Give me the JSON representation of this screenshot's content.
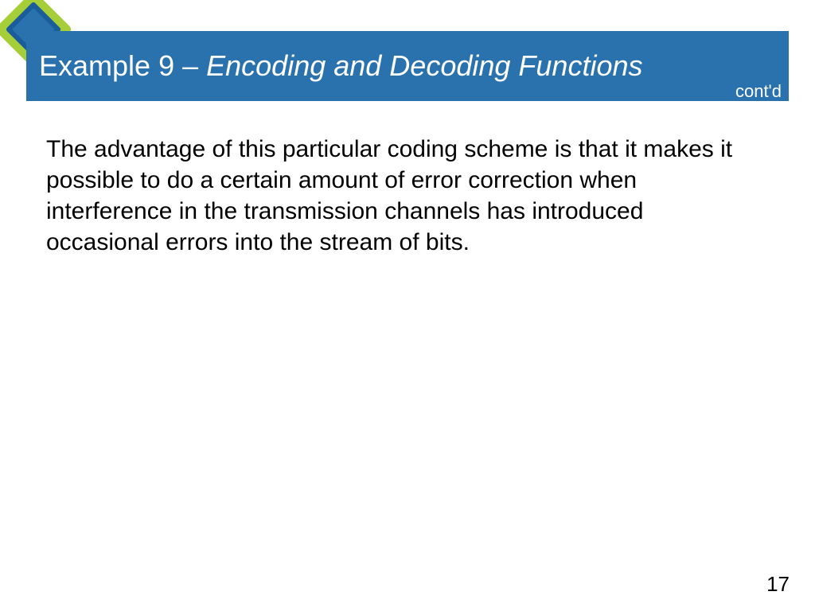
{
  "header": {
    "title_prefix": "Example 9 – ",
    "title_subject": "Encoding and Decoding Functions",
    "contd": "cont'd"
  },
  "body": {
    "paragraph": "The advantage of this particular coding scheme is that it makes it possible to do a certain amount of error correction when interference in the transmission channels has introduced occasional errors into the stream of bits."
  },
  "footer": {
    "page_number": "17"
  },
  "colors": {
    "header_bg": "#2a72ad",
    "accent_green": "#a6ce39",
    "diamond_dark": "#1b5d9b"
  }
}
